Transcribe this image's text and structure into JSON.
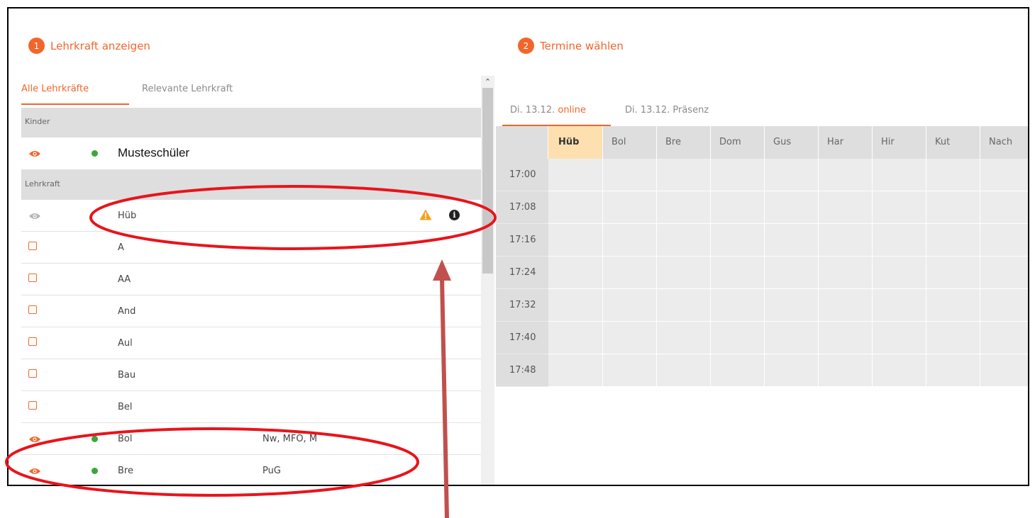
{
  "step1": {
    "number": "1",
    "title": "Lehrkraft anzeigen"
  },
  "step2": {
    "number": "2",
    "title": "Termine wählen"
  },
  "left_tabs": [
    {
      "label": "Alle Lehrkräfte",
      "active": true
    },
    {
      "label": "Relevante Lehrkraft",
      "active": false
    }
  ],
  "sections": {
    "kinder": "Kinder",
    "lehrkraft": "Lehrkraft"
  },
  "student": {
    "name": "Musteschüler",
    "icon": "eye-icon"
  },
  "teachers": [
    {
      "name": "Hüb",
      "icon": "eye-icon",
      "subjects": ""
    },
    {
      "name": "A",
      "icon": "checkbox",
      "subjects": ""
    },
    {
      "name": "AA",
      "icon": "checkbox",
      "subjects": ""
    },
    {
      "name": "And",
      "icon": "checkbox",
      "subjects": ""
    },
    {
      "name": "Aul",
      "icon": "checkbox",
      "subjects": ""
    },
    {
      "name": "Bau",
      "icon": "checkbox",
      "subjects": ""
    },
    {
      "name": "Bel",
      "icon": "checkbox",
      "subjects": ""
    },
    {
      "name": "Bol",
      "icon": "eye-icon",
      "subjects": "Nw, MFÖ, M"
    },
    {
      "name": "Bre",
      "icon": "eye-icon",
      "subjects": "PuG"
    }
  ],
  "right_tabs": [
    {
      "prefix": "Di. 13.12. ",
      "mode": "online",
      "active": true
    },
    {
      "prefix": "Di. 13.12. ",
      "mode": "Präsenz",
      "active": false
    }
  ],
  "grid": {
    "columns": [
      "Hüb",
      "Bol",
      "Bre",
      "Dom",
      "Gus",
      "Har",
      "Hir",
      "Kut",
      "Nach"
    ],
    "times": [
      "17:00",
      "17:08",
      "17:16",
      "17:24",
      "17:32",
      "17:40",
      "17:48"
    ]
  },
  "colors": {
    "accent": "#f2662b",
    "online_dot": "#3ca63a",
    "highlight": "#fddfb0",
    "annotation": "#e8141b"
  }
}
